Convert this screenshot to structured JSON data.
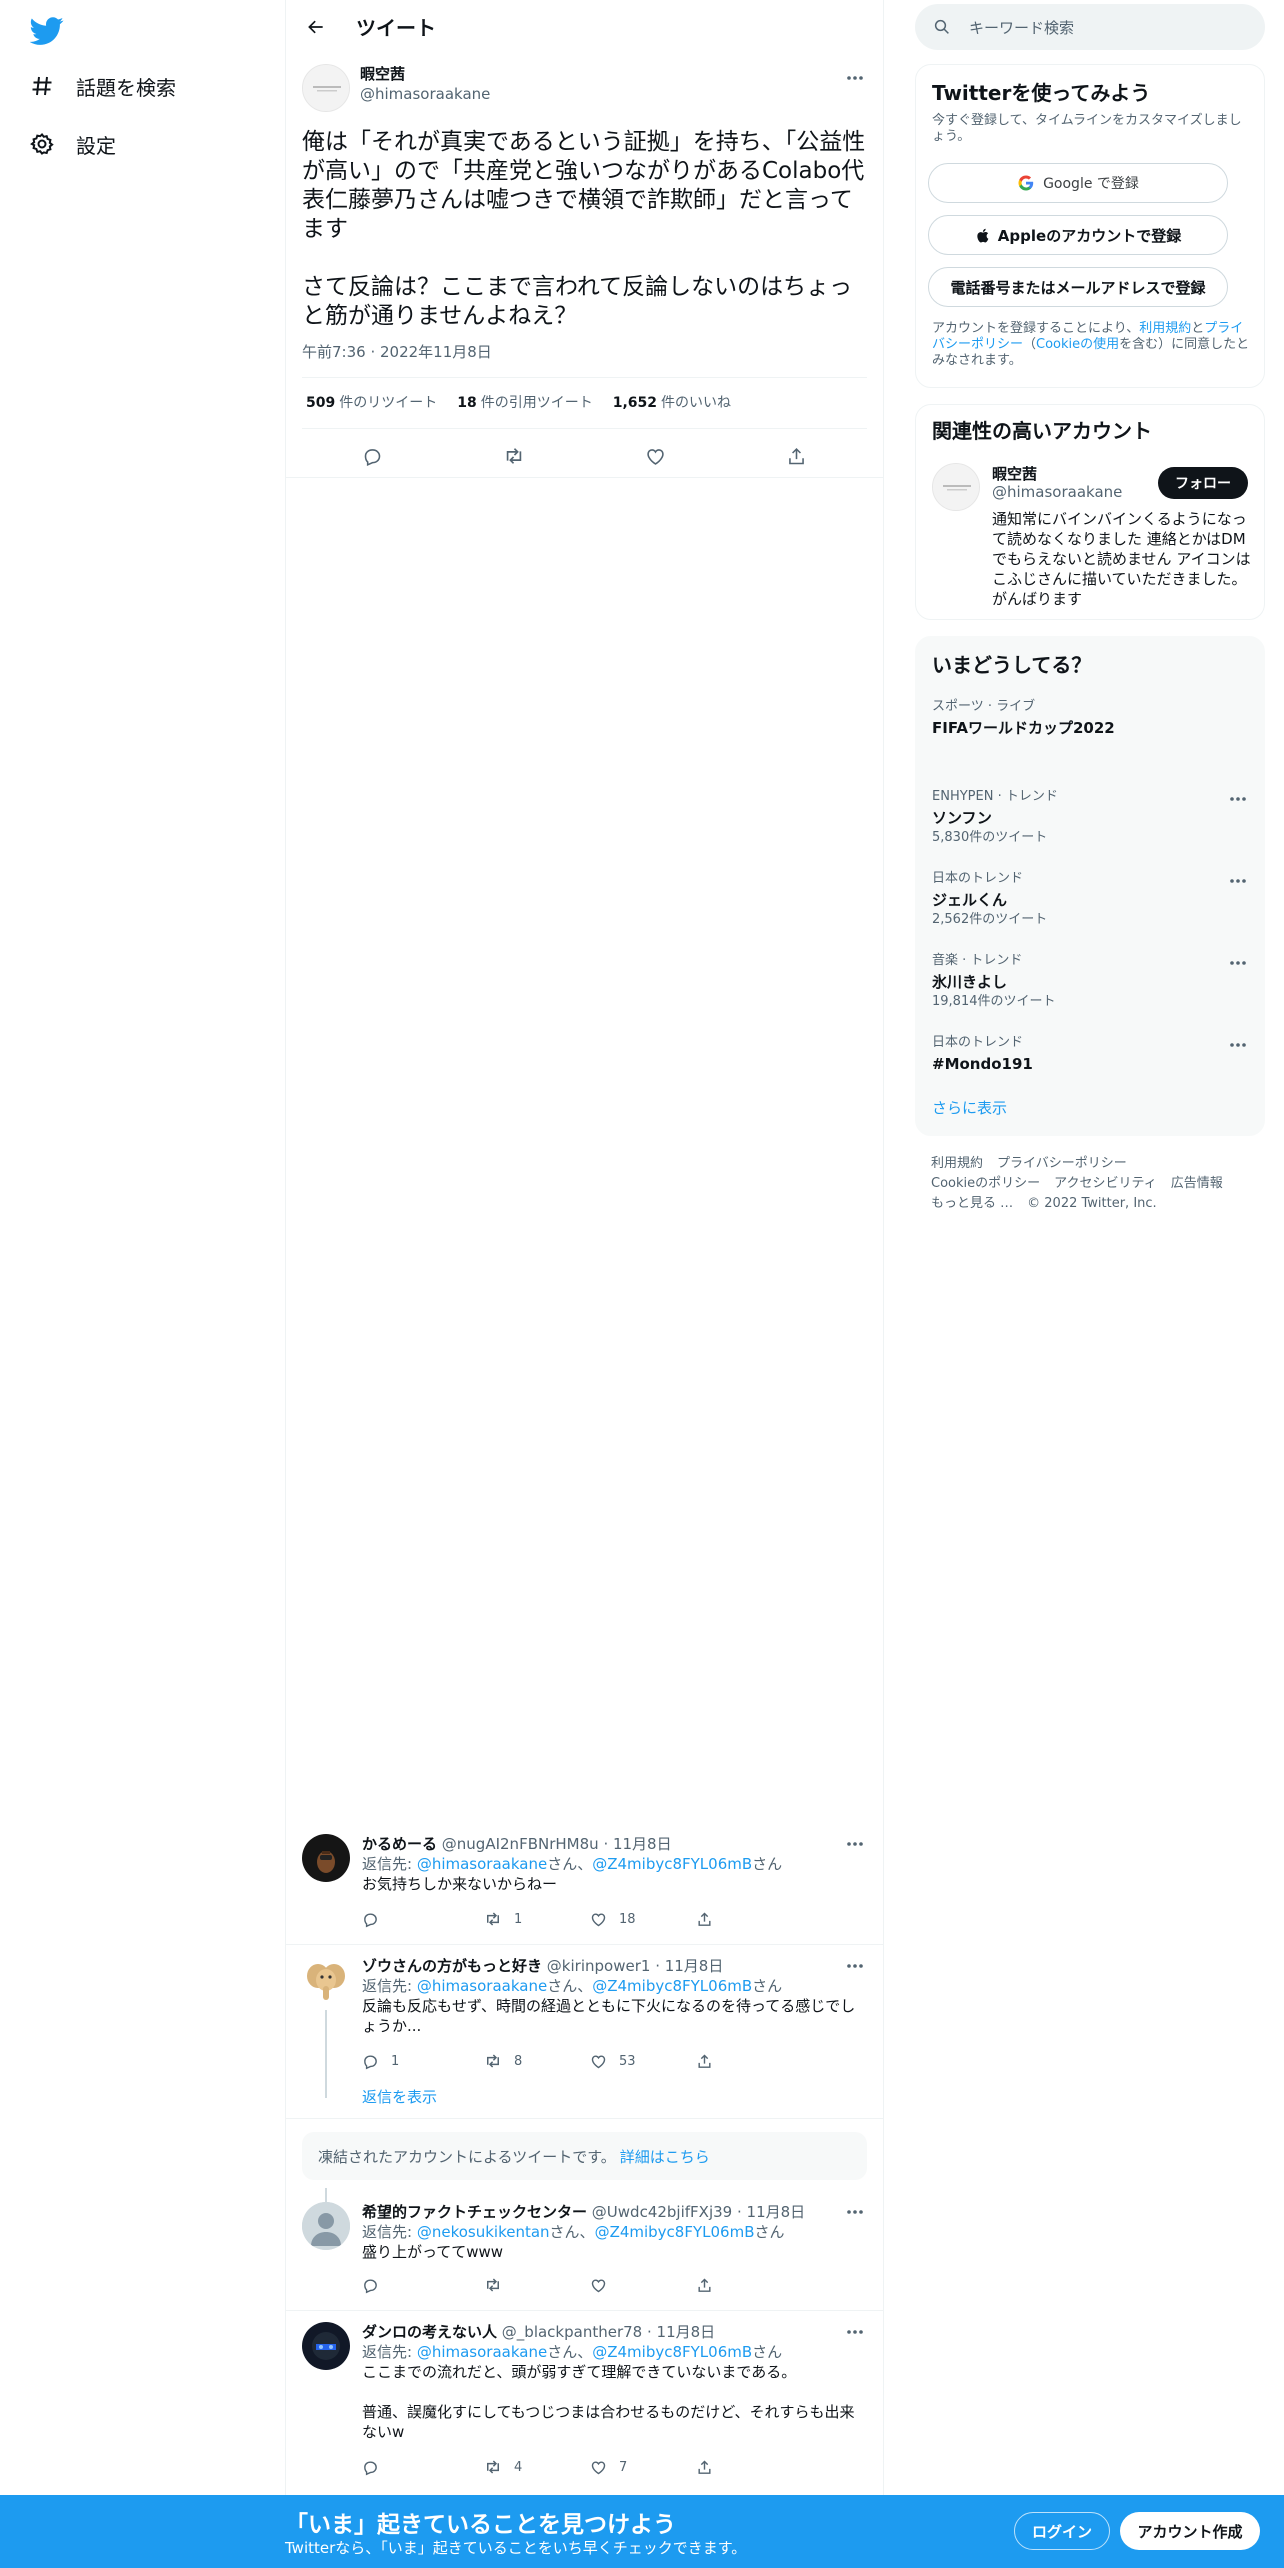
{
  "nav": {
    "items": [
      {
        "label": "話題を検索",
        "icon": "hashtag-icon"
      },
      {
        "label": "設定",
        "icon": "gear-icon"
      }
    ]
  },
  "header": {
    "title": "ツイート"
  },
  "tweet": {
    "author_name": "暇空茜",
    "author_handle": "@himasoraakane",
    "text": "俺は「それが真実であるという証拠」を持ち、「公益性が高い」ので「共産党と強いつながりがあるColabo代表仁藤夢乃さんは嘘つきで横領で詐欺師」だと言ってます\n\nさて反論は？ここまで言われて反論しないのはちょっと筋が通りませんよねえ？",
    "timestamp": "午前7:36 · 2022年11月8日",
    "stats": {
      "retweets": "509",
      "retweets_label": "件のリツイート",
      "quotes": "18",
      "quotes_label": "件の引用ツイート",
      "likes": "1,652",
      "likes_label": "件のいいね"
    }
  },
  "replies": [
    {
      "name": "かるめーる",
      "handle": "@nugAI2nFBNrHM8u",
      "date": "· 11月8日",
      "to_prefix": "返信先: ",
      "to1": "@himasoraakane",
      "to_mid": "さん、",
      "to2": "@Z4mibyc8FYL06mB",
      "to_suffix": "さん",
      "text": "お気持ちしか来ないからねー",
      "counts": {
        "reply": "",
        "retweet": "1",
        "like": "18"
      }
    },
    {
      "name": "ゾウさんの方がもっと好き",
      "handle": "@kirinpower1",
      "date": "· 11月8日",
      "to_prefix": "返信先: ",
      "to1": "@himasoraakane",
      "to_mid": "さん、",
      "to2": "@Z4mibyc8FYL06mB",
      "to_suffix": "さん",
      "text": "反論も反応もせず、時間の経過とともに下火になるのを待ってる感じでしょうか...",
      "counts": {
        "reply": "1",
        "retweet": "8",
        "like": "53"
      }
    },
    {
      "name": "希望的ファクトチェックセンター",
      "handle": "@Uwdc42bjifFXj39",
      "date": "· 11月8日",
      "to_prefix": "返信先: ",
      "to1": "@nekosukikentan",
      "to_mid": "さん、",
      "to2": "@Z4mibyc8FYL06mB",
      "to_suffix": "さん",
      "text": "盛り上がっててwww",
      "counts": {
        "reply": "",
        "retweet": "",
        "like": ""
      }
    },
    {
      "name": "ダンロの考えない人",
      "handle": "@_blackpanther78",
      "date": "· 11月8日",
      "to_prefix": "返信先: ",
      "to1": "@himasoraakane",
      "to_mid": "さん、",
      "to2": "@Z4mibyc8FYL06mB",
      "to_suffix": "さん",
      "text": "ここまでの流れだと、頭が弱すぎて理解できていないまである。\n\n普通、誤魔化すにしてもつじつまは合わせるものだけど、それすらも出来ないw",
      "counts": {
        "reply": "",
        "retweet": "4",
        "like": "7"
      }
    }
  ],
  "show_replies": "返信を表示",
  "frozen": {
    "text": "凍結されたアカウントによるツイートです。",
    "link": "詳細はこちら"
  },
  "search": {
    "placeholder": "キーワード検索"
  },
  "signup_card": {
    "title": "Twitterを使ってみよう",
    "desc": "今すぐ登録して、タイムラインをカスタマイズしましょう。",
    "google": "Google で登録",
    "apple": "Appleのアカウントで登録",
    "phone": "電話番号またはメールアドレスで登録",
    "legal_1": "アカウントを登録することにより、",
    "legal_link1": "利用規約",
    "legal_2": "と",
    "legal_link2": "プライバシーポリシー",
    "legal_3": "（",
    "legal_link3": "Cookieの使用",
    "legal_4": "を含む）に同意したとみなされます。"
  },
  "related": {
    "title": "関連性の高いアカウント",
    "name": "暇空茜",
    "handle": "@himasoraakane",
    "follow": "フォロー",
    "bio": "通知常にバインバインくるようになって読めなくなりました 連絡とかはDMでもらえないと読めません アイコンはこふじさんに描いていただきました。 がんばります"
  },
  "trends": {
    "title": "いまどうしてる？",
    "items": [
      {
        "context": "スポーツ · ライブ",
        "name": "FIFAワールドカップ2022",
        "count": ""
      },
      {
        "context": "ENHYPEN · トレンド",
        "name": "ソンフン",
        "count": "5,830件のツイート"
      },
      {
        "context": "日本のトレンド",
        "name": "ジェルくん",
        "count": "2,562件のツイート"
      },
      {
        "context": "音楽 · トレンド",
        "name": "氷川きよし",
        "count": "19,814件のツイート"
      },
      {
        "context": "日本のトレンド",
        "name": "#Mondo191",
        "count": ""
      }
    ],
    "show_more": "さらに表示"
  },
  "footer": {
    "links": [
      "利用規約",
      "プライバシーポリシー",
      "Cookieのポリシー",
      "アクセシビリティ",
      "広告情報",
      "もっと見る …"
    ],
    "copyright": "© 2022 Twitter, Inc."
  },
  "bottom_bar": {
    "title": "「いま」起きていることを見つけよう",
    "subtitle": "Twitterなら、「いま」起きていることをいち早くチェックできます。",
    "login": "ログイン",
    "signup": "アカウント作成"
  },
  "colors": {
    "accent": "#1d9bf0",
    "text": "#0f1419",
    "secondary": "#536471"
  }
}
